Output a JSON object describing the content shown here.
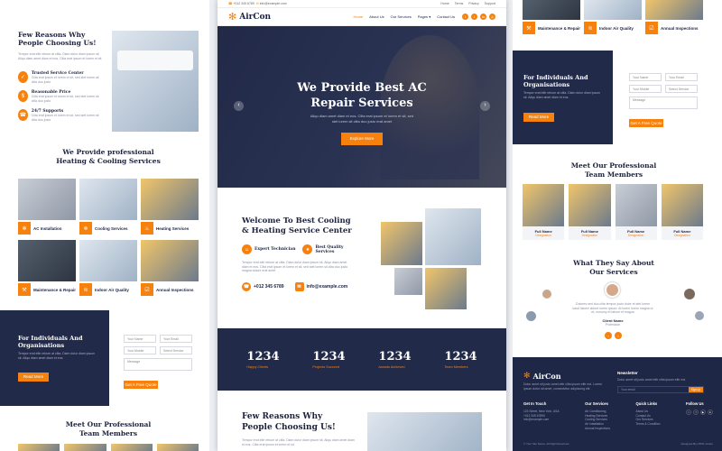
{
  "brand": {
    "name": "AirCon",
    "accent": "#f7810d",
    "navy": "#222a4a"
  },
  "topbar": {
    "phone": "+012 345 6789",
    "email": "info@example.com",
    "links": [
      "Home",
      "Terms",
      "Privacy",
      "Support"
    ]
  },
  "nav": {
    "items": [
      "Home",
      "About Us",
      "Our Services",
      "Pages",
      "Contact Us"
    ]
  },
  "hero": {
    "title": "We Provide Best AC Repair Services",
    "text": "Aliqu diam amet diam et eos. Clita erat ipsum et lorem et sit, sed stet lorem sit clita duo justo erat amet",
    "cta": "Explore More",
    "prev": "‹",
    "next": "›"
  },
  "welcome": {
    "title": "Welcome To Best Cooling & Heating Service Center",
    "feature1": "Expert Technician",
    "feature2": "Best Quality Services",
    "text": "Tempor erat elitr rebum at clita. Diam dolor diam ipsum sit. Aliqu diam amet diam et eos. Clita erat ipsum et lorem et sit, sed stet lorem sit clita duo justo magna dolore erat amet",
    "phone": "+012 345 6789",
    "email": "info@example.com"
  },
  "stats": [
    {
      "value": "1234",
      "label": "Happy Clients"
    },
    {
      "value": "1234",
      "label": "Projects Succeed"
    },
    {
      "value": "1234",
      "label": "Awards Achieved"
    },
    {
      "value": "1234",
      "label": "Team Members"
    }
  ],
  "reasons": {
    "title": "Few Reasons Why People Choosing Us!",
    "intro": "Tempor erat elitr rebum at clita. Diam dolor diam ipsum sit. Aliqu diam amet diam et eos. Clita erat ipsum et lorem et sit.",
    "items": [
      {
        "title": "Trusted Service Center",
        "text": "Clita erat ipsum et lorem et sit, sed stet lorem sit clita duo justo"
      },
      {
        "title": "Reasonable Price",
        "text": "Clita erat ipsum et lorem et sit, sed stet lorem sit clita duo justo"
      },
      {
        "title": "24/7 Supports",
        "text": "Clita erat ipsum et lorem et sit, sed stet lorem sit clita duo justo"
      }
    ]
  },
  "services": {
    "title": "We Provide professional Heating & Cooling Services",
    "items": [
      "AC Installation",
      "Cooling Services",
      "Heating Services",
      "Maintenance & Repair",
      "Indoor Air Quality",
      "Annual Inspections"
    ]
  },
  "quote": {
    "title": "For Individuals And Organisations",
    "text": "Tempor erat elitr rebum at clita. Diam dolor diam ipsum sit. Aliqu diam amet diam et eos.",
    "button": "Read More",
    "name_ph": "Your Name",
    "email_ph": "Your Email",
    "mobile_ph": "Your Mobile",
    "service_ph": "Select Service",
    "message_ph": "Message",
    "submit": "Get A Free Quote"
  },
  "team": {
    "title": "Meet Our Professional Team Members",
    "members": [
      {
        "name": "Full Name",
        "role": "Designation"
      },
      {
        "name": "Full Name",
        "role": "Designation"
      },
      {
        "name": "Full Name",
        "role": "Designation"
      },
      {
        "name": "Full Name",
        "role": "Designation"
      }
    ]
  },
  "testimonials": {
    "title": "What They Say About Our Services",
    "text": "Dolores sed duo clita tempor justo dolor et stet lorem kasd labore dolore lorem ipsum. At lorem lorem magna ut et, nonumy et labore et magna",
    "name": "Client Name",
    "role": "Profession"
  },
  "footer": {
    "about": "Dolor amet sit justo amet elitr clita ipsum elitr est. Lorem ipsum dolor sit amet, consectetur adipiscing elit.",
    "newsletter_title": "Newsletter",
    "newsletter_text": "Dolor amet sit justo amet elitr clita ipsum elitr est.",
    "newsletter_ph": "Your email",
    "newsletter_btn": "SignUp",
    "touch_title": "Get In Touch",
    "touch": [
      "123 Street, New York, USA",
      "+012 345 67890",
      "info@example.com"
    ],
    "services_title": "Our Services",
    "services": [
      "Air Conditioning",
      "Heating Services",
      "Cooling Services",
      "Air Installation",
      "Annual Inspections"
    ],
    "quick_title": "Quick Links",
    "quick": [
      "About Us",
      "Contact Us",
      "Our Services",
      "Terms & Condition"
    ],
    "follow_title": "Follow Us",
    "copyright": "© Your Site Name, All Right Reserved.",
    "designed": "Designed By HTML Codex"
  }
}
